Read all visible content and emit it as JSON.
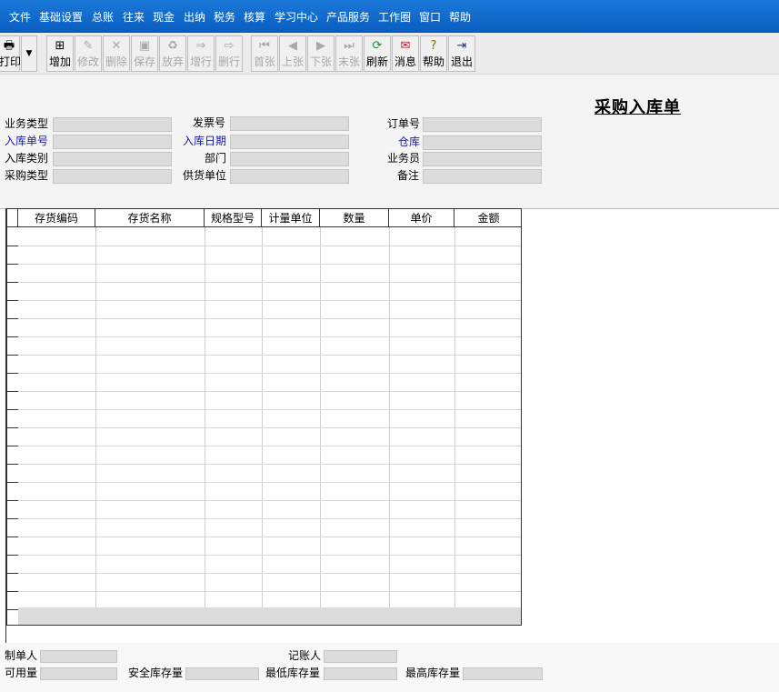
{
  "menu": [
    "文件",
    "基础设置",
    "总账",
    "往来",
    "现金",
    "出纳",
    "税务",
    "核算",
    "学习中心",
    "产品服务",
    "工作圈",
    "窗口",
    "帮助"
  ],
  "toolbar": {
    "print": "打印",
    "add": "增加",
    "edit": "修改",
    "delete": "删除",
    "save": "保存",
    "discard": "放弃",
    "add_row": "增行",
    "delete_row": "删行",
    "first": "首张",
    "prev": "上张",
    "next": "下张",
    "last": "末张",
    "refresh": "刷新",
    "message": "消息",
    "help": "帮助",
    "exit": "退出"
  },
  "form": {
    "title": "采购入库单",
    "business_type": "业务类型",
    "invoice_no": "发票号",
    "order_no": "订单号",
    "receipt_no": "入库单号",
    "receipt_date": "入库日期",
    "warehouse": "仓库",
    "receipt_category": "入库类别",
    "department": "部门",
    "salesperson": "业务员",
    "purchase_type": "采购类型",
    "supplier": "供货单位",
    "remark": "备注"
  },
  "grid": {
    "columns": [
      "存货编码",
      "存货名称",
      "规格型号",
      "计量单位",
      "数量",
      "单价",
      "金额"
    ]
  },
  "footer": {
    "maker": "制单人",
    "bookkeeper": "记账人",
    "available": "可用量",
    "safety_stock": "安全库存量",
    "min_stock": "最低库存量",
    "max_stock": "最高库存量"
  },
  "colors": {
    "menubar": "#0a5fc1",
    "required_label": "#1a1aa0",
    "field_bg": "#dcdcdc"
  }
}
